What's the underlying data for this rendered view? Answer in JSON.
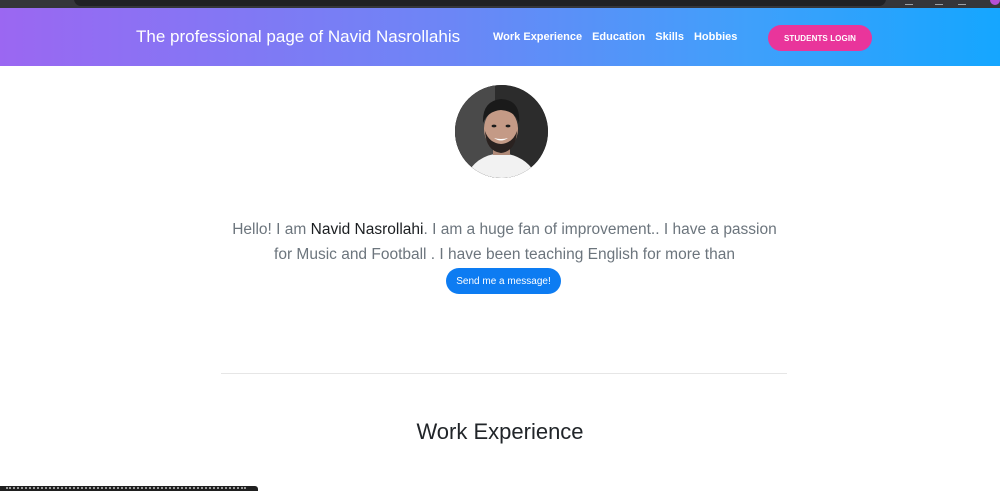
{
  "header": {
    "brand": "The professional page of Navid Nasrollahis",
    "nav": [
      "Work Experience",
      "Education",
      "Skills",
      "Hobbies"
    ],
    "login_label": "STUDENTS LOGIN"
  },
  "hero": {
    "greeting": "Hello! I am ",
    "name": "Navid Nasrollahi",
    "bio": ". I am a huge fan of improvement.. I have a passion for Music and Football . I have been teaching English for more than",
    "message_button": "Send me a message!"
  },
  "sections": {
    "work_title": "Work Experience"
  },
  "colors": {
    "header_gradient_start": "#9b67f2",
    "header_gradient_end": "#15a6ff",
    "login_button": "#e9359b",
    "message_button": "#0d7cf2"
  },
  "icons": {
    "avatar": "profile-photo"
  }
}
